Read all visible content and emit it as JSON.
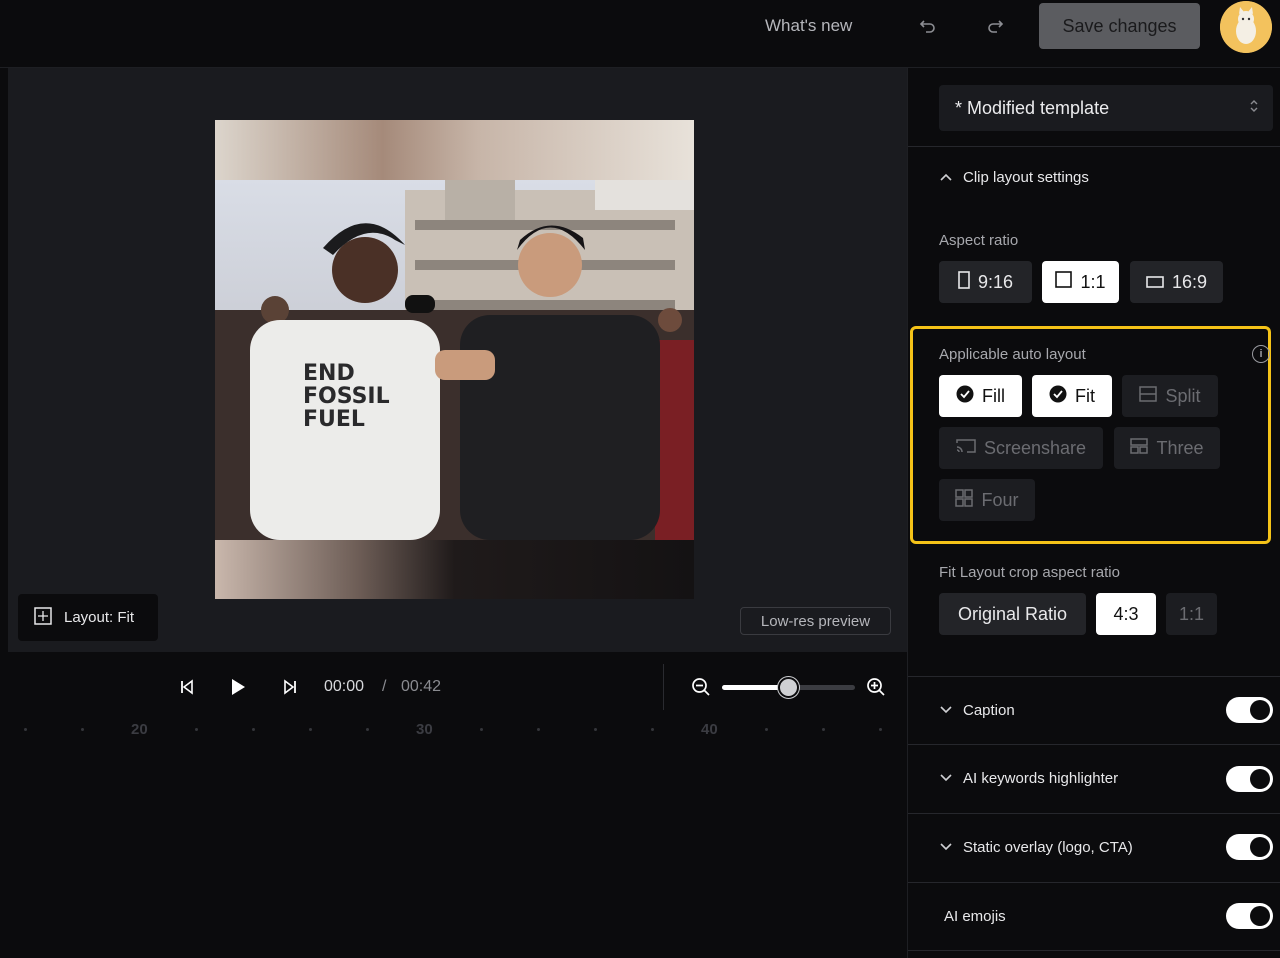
{
  "topbar": {
    "whats_new": "What's new",
    "undo_icon": "undo-icon",
    "redo_icon": "redo-icon",
    "save_label": "Save changes",
    "avatar_icon": "avatar"
  },
  "stage": {
    "layout_chip_label": "Layout: Fit",
    "layout_chip_icon": "layout-icon",
    "lowres_label": "Low-res preview"
  },
  "player": {
    "current_time": "00:00",
    "separator": "/",
    "duration": "00:42",
    "zoom_level": 0.5,
    "ruler_marks": [
      "20",
      "30",
      "40"
    ]
  },
  "panel": {
    "template": "* Modified template",
    "clip_layout_title": "Clip layout settings",
    "aspect_ratio_label": "Aspect ratio",
    "aspect_ratios": [
      {
        "label": "9:16",
        "selected": false
      },
      {
        "label": "1:1",
        "selected": true
      },
      {
        "label": "16:9",
        "selected": false
      }
    ],
    "auto_layout_label": "Applicable auto layout",
    "auto_layouts": [
      {
        "label": "Fill",
        "checked": true
      },
      {
        "label": "Fit",
        "checked": true
      },
      {
        "label": "Split",
        "checked": false
      },
      {
        "label": "Screenshare",
        "checked": false
      },
      {
        "label": "Three",
        "checked": false
      },
      {
        "label": "Four",
        "checked": false
      }
    ],
    "fit_crop_label": "Fit Layout crop aspect ratio",
    "fit_crop_options": [
      {
        "label": "Original Ratio",
        "selected": false
      },
      {
        "label": "4:3",
        "selected": true
      },
      {
        "label": "1:1",
        "selected": false
      }
    ],
    "sections": [
      {
        "label": "Caption",
        "enabled": true
      },
      {
        "label": "AI keywords highlighter",
        "enabled": true
      },
      {
        "label": "Static overlay (logo, CTA)",
        "enabled": true
      },
      {
        "label": "AI emojis",
        "enabled": true
      }
    ]
  },
  "colors": {
    "accent_highlight": "#f5c318",
    "background": "#0b0b0d",
    "stage": "#1a1b1f"
  }
}
